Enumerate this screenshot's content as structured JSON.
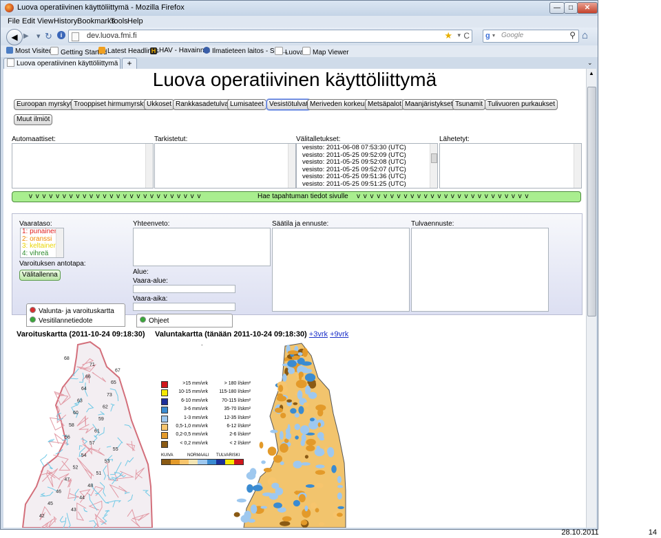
{
  "window": {
    "title": "Luova operatiivinen käyttöliittymä - Mozilla Firefox"
  },
  "menu": [
    "File",
    "Edit",
    "View",
    "History",
    "Bookmarks",
    "Tools",
    "Help"
  ],
  "nav": {
    "url": "dev.luova.fmi.fi",
    "search_placeholder": "Google"
  },
  "bookmarks": [
    "Most Visited",
    "Getting Started",
    "Latest Headlines",
    "HAV - Havainnot",
    "Ilmatieteen laitos - Sää...",
    "Luova",
    "Map Viewer"
  ],
  "tab": {
    "label": "Luova operatiivinen käyttöliittymä",
    "new_tab": "+"
  },
  "page": {
    "title": "Luova operatiivinen käyttöliittymä",
    "categories": [
      "Euroopan myrskyt",
      "Trooppiset hirmumyrskyt",
      "Ukkoset",
      "Rankkasadetulvat",
      "Lumisateet",
      "Vesistötulvat",
      "Meriveden korkeus",
      "Metsäpalot",
      "Maanjäristykset",
      "Tsunamit",
      "Tulivuoren purkaukset",
      "Muut ilmiöt"
    ],
    "selected_category": "Vesistötulvat",
    "lists": {
      "automaattiset": "Automaattiset:",
      "tarkistetut": "Tarkistetut:",
      "valitalletukset": "Välitalletukset:",
      "lahetetyt": "Lähetetyt:"
    },
    "valitalletukset_items": [
      "vesisto: 2011-06-08 07:53:30 (UTC)",
      "vesisto: 2011-05-25 09:52:09 (UTC)",
      "vesisto: 2011-05-25 09:52:08 (UTC)",
      "vesisto: 2011-05-25 09:52:07 (UTC)",
      "vesisto: 2011-05-25 09:51:36 (UTC)",
      "vesisto: 2011-05-25 09:51:25 (UTC)"
    ],
    "hae_bar": {
      "arrows": "v v v v v v v v v v v v v v v v v v v v v v v v v v",
      "label": "Hae tapahtuman tiedot sivulle"
    },
    "form": {
      "vaarataso_label": "Vaarataso:",
      "vaarataso_options": [
        {
          "text": "1: punainen",
          "color": "#e02020"
        },
        {
          "text": "2: oranssi",
          "color": "#f08a00"
        },
        {
          "text": "3: keltainen",
          "color": "#e8d400"
        },
        {
          "text": "4: vihreä",
          "color": "#2a8a2a"
        }
      ],
      "antotapa_label": "Varoituksen antotapa:",
      "valitallenna": "Välitallenna",
      "yhteenveto": "Yhteenveto:",
      "alue": "Alue:",
      "vaara_alue": "Vaara-alue:",
      "vaara_aika": "Vaara-aika:",
      "saatila": "Säätila ja ennuste:",
      "tulvaennuste": "Tulvaennuste:"
    },
    "radio": {
      "valunta": "Valunta- ja varoituskartta",
      "vesitilanne": "Vesitilannetiedote",
      "ohjeet": "Ohjeet"
    },
    "maps": {
      "varoitus_title": "Varoituskartta (2011-10-24 09:18:30)",
      "valunta_title": "Valuntakartta (tänään 2011-10-24 09:18:30)",
      "link1": "+3vrk",
      "link2": "+9vrk",
      "region_numbers": [
        "68",
        "71",
        "67",
        "66",
        "65",
        "64",
        "73",
        "63",
        "62",
        "60",
        "59",
        "58",
        "61",
        "56",
        "57",
        "55",
        "54",
        "53",
        "52",
        "51",
        "47",
        "48",
        "46",
        "44",
        "45",
        "43",
        "42"
      ],
      "legend": [
        {
          "a": ">15 mm/vrk",
          "b": "> 180 l/skm²",
          "color": "#d0161b"
        },
        {
          "a": "10-15 mm/vrk",
          "b": "115-180 l/skm²",
          "color": "#f5e800"
        },
        {
          "a": "6-10 mm/vrk",
          "b": "70-115 l/skm²",
          "color": "#1c2f9a"
        },
        {
          "a": "3-6 mm/vrk",
          "b": "35-70 l/skm²",
          "color": "#3a8bd1"
        },
        {
          "a": "1-3 mm/vrk",
          "b": "12-35 l/skm²",
          "color": "#9ec8ef"
        },
        {
          "a": "0,5-1,0 mm/vrk",
          "b": "6-12 l/skm²",
          "color": "#f7c56d"
        },
        {
          "a": "0,2-0,5 mm/vrk",
          "b": "2-6 l/skm²",
          "color": "#e39a2a"
        },
        {
          "a": "< 0,2 mm/vrk",
          "b": "< 2 l/skm²",
          "color": "#8a5a14"
        }
      ],
      "scale_labels": [
        "KUIVA",
        "NORMAALI",
        "TULVARISKI"
      ],
      "scale_colors": [
        "#8a5a14",
        "#e39a2a",
        "#f7c56d",
        "#f2e4b3",
        "#9ec8ef",
        "#3a8bd1",
        "#1c2f9a",
        "#f5e800",
        "#d0161b"
      ]
    }
  },
  "footer": {
    "date": "28.10.2011",
    "page": "14"
  }
}
